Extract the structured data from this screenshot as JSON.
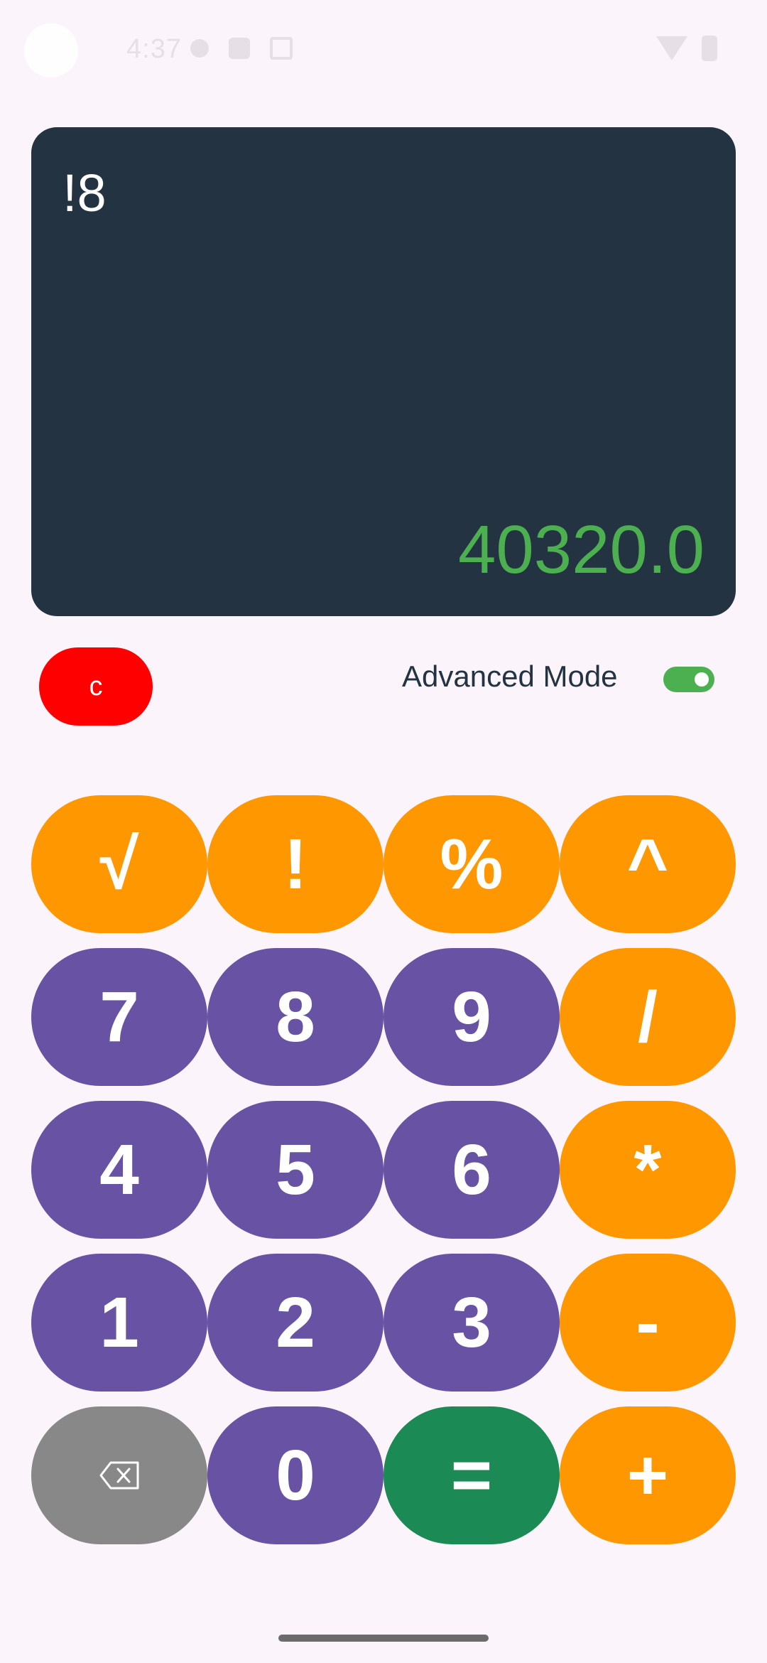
{
  "status_bar": {
    "time": "4:37",
    "icons": [
      "notification-icon",
      "sim-icon",
      "screenshot-icon",
      "wifi-icon",
      "battery-icon"
    ]
  },
  "display": {
    "expression": "!8",
    "result": "40320.0",
    "background_color": "#243342",
    "result_color": "#4caf50"
  },
  "controls": {
    "clear_label": "c",
    "advanced_mode_label": "Advanced Mode",
    "advanced_mode_on": true
  },
  "keypad": {
    "rows": [
      [
        {
          "label": "√",
          "type": "operator"
        },
        {
          "label": "!",
          "type": "operator"
        },
        {
          "label": "%",
          "type": "operator"
        },
        {
          "label": "^",
          "type": "operator"
        }
      ],
      [
        {
          "label": "7",
          "type": "digit"
        },
        {
          "label": "8",
          "type": "digit"
        },
        {
          "label": "9",
          "type": "digit"
        },
        {
          "label": "/",
          "type": "operator"
        }
      ],
      [
        {
          "label": "4",
          "type": "digit"
        },
        {
          "label": "5",
          "type": "digit"
        },
        {
          "label": "6",
          "type": "digit"
        },
        {
          "label": "*",
          "type": "operator"
        }
      ],
      [
        {
          "label": "1",
          "type": "digit"
        },
        {
          "label": "2",
          "type": "digit"
        },
        {
          "label": "3",
          "type": "digit"
        },
        {
          "label": "-",
          "type": "operator"
        }
      ],
      [
        {
          "label": "",
          "type": "backspace",
          "icon": "backspace-icon"
        },
        {
          "label": "0",
          "type": "digit"
        },
        {
          "label": "=",
          "type": "equals"
        },
        {
          "label": "+",
          "type": "operator"
        }
      ]
    ]
  },
  "colors": {
    "operator": "#ff9800",
    "digit": "#6752a3",
    "backspace": "#888888",
    "equals": "#1b8a55",
    "clear": "#ff0000",
    "page_background": "#fcf4fb"
  }
}
